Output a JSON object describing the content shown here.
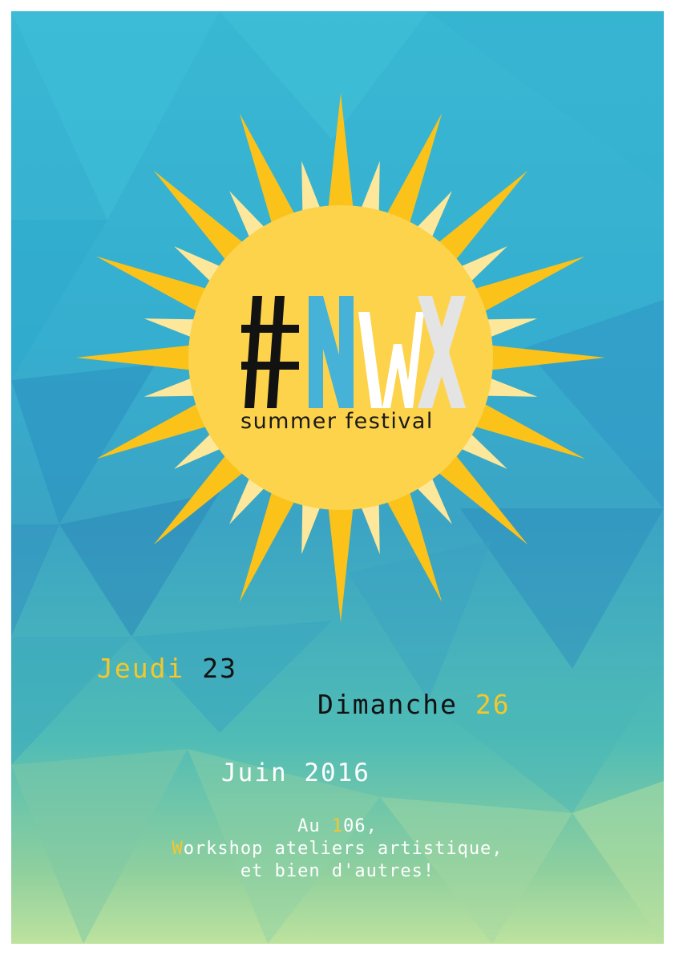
{
  "colors": {
    "sun_core": "#fdd34c",
    "sun_ray_dark": "#fbc21a",
    "sun_ray_light": "#fde79a",
    "accent_yellow": "#f5c72a",
    "logo_dark": "#121212",
    "logo_blue": "#47b2d8",
    "logo_white": "#ffffff",
    "logo_grey": "#e4e4e4"
  },
  "logo": {
    "hash": "#",
    "letters": [
      "N",
      "W",
      "X"
    ]
  },
  "subtitle": "summer festival",
  "dates": {
    "start_day": "Jeudi",
    "start_num": "23",
    "end_day": "Dimanche",
    "end_num": "26",
    "month_year": "Juin 2016"
  },
  "info": {
    "line1_prefix": "Au ",
    "line1_highlight": "1",
    "line1_rest": "06,",
    "line2_highlight": "W",
    "line2_rest": "orkshop ateliers artistique,",
    "line3": "et bien d'autres!"
  }
}
